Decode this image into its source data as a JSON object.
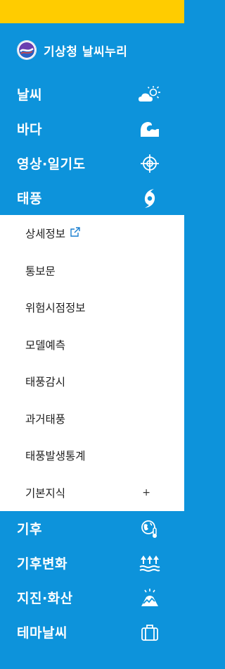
{
  "header": {
    "logo_icon": "kma-emblem-icon",
    "site_name": "기상청 날씨누리"
  },
  "menu": [
    {
      "label": "날씨",
      "icon": "weather-sun-cloud-icon"
    },
    {
      "label": "바다",
      "icon": "ocean-wave-icon"
    },
    {
      "label": "영상·일기도",
      "icon": "radar-target-icon"
    },
    {
      "label": "태풍",
      "icon": "typhoon-icon"
    },
    {
      "label": "기후",
      "icon": "globe-thermometer-icon"
    },
    {
      "label": "기후변화",
      "icon": "climate-change-icon"
    },
    {
      "label": "지진·화산",
      "icon": "earthquake-volcano-icon"
    },
    {
      "label": "테마날씨",
      "icon": "briefcase-icon"
    }
  ],
  "submenu": [
    {
      "label": "상세정보",
      "icon": "external-link-icon"
    },
    {
      "label": "통보문"
    },
    {
      "label": "위험시점정보"
    },
    {
      "label": "모델예측"
    },
    {
      "label": "태풍감시"
    },
    {
      "label": "과거태풍"
    },
    {
      "label": "태풍발생통계"
    },
    {
      "label": "기본지식",
      "expand": "+"
    }
  ],
  "colors": {
    "top_bar": "#ffcc00",
    "sidebar_bg": "#0d93db",
    "submenu_bg": "#ffffff",
    "link_icon": "#1a7fd0"
  }
}
